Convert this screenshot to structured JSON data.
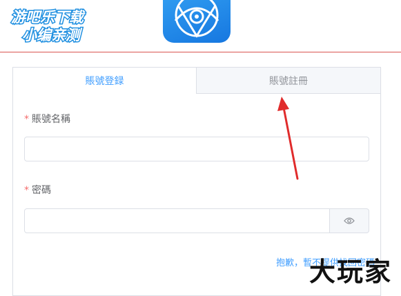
{
  "watermark_top": {
    "line1": "游吧乐下载",
    "line2": "小编亲测"
  },
  "tabs": [
    {
      "label": "賬號登録"
    },
    {
      "label": "賬號註冊"
    }
  ],
  "form": {
    "username": {
      "required_mark": "*",
      "label": "賬號名稱",
      "value": ""
    },
    "password": {
      "required_mark": "*",
      "label": "密碼",
      "value": ""
    }
  },
  "notice": "抱歉，暫不提供找回密碼",
  "watermark_bottom": "大玩家",
  "colors": {
    "accent": "#409eff",
    "arrow": "#e02b2b",
    "divider": "#d9534f"
  }
}
